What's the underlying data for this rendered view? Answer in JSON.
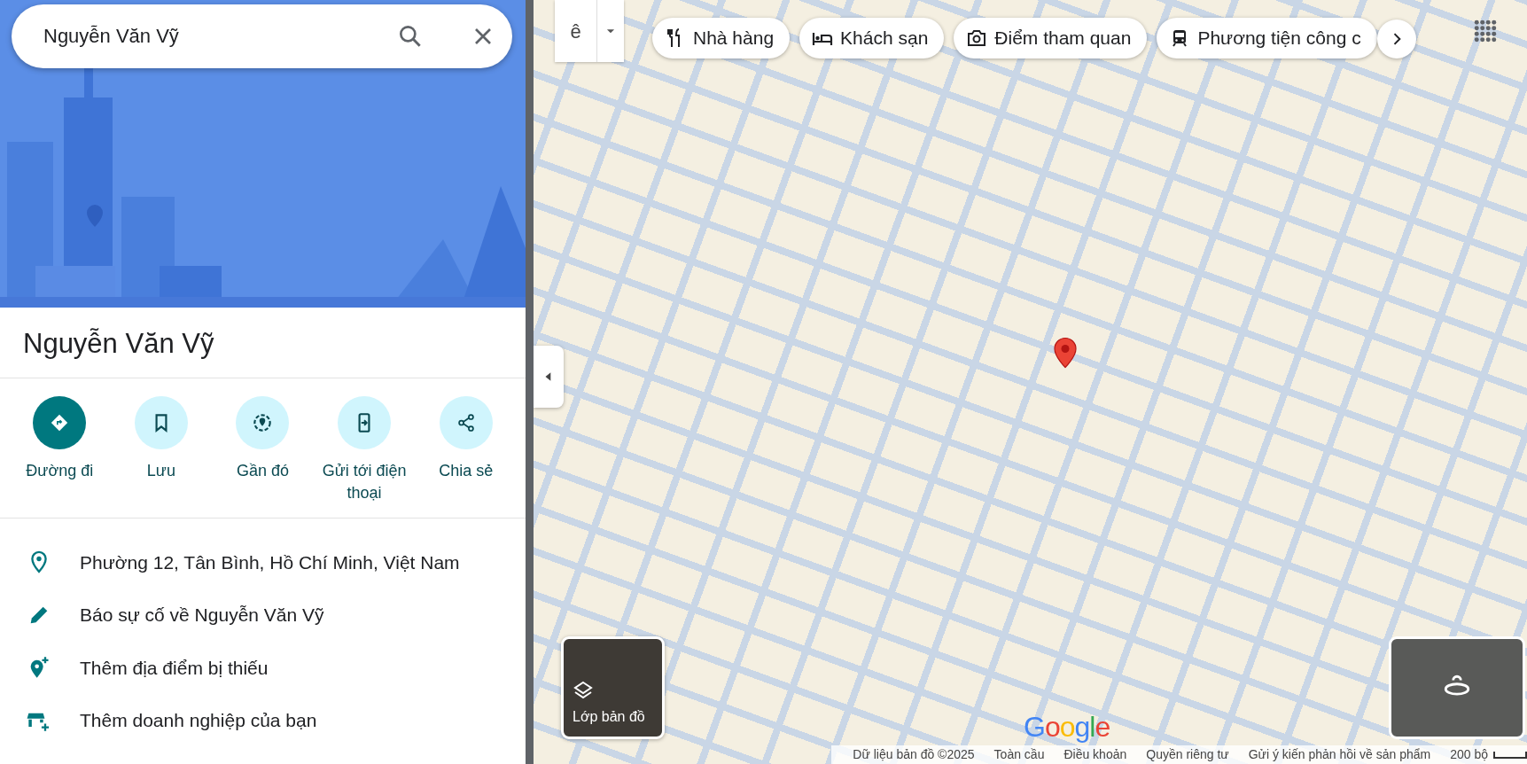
{
  "search": {
    "value": "Nguyễn Văn Vỹ"
  },
  "place": {
    "title": "Nguyễn Văn Vỹ"
  },
  "actions": [
    {
      "label": "Đường đi",
      "primary": true
    },
    {
      "label": "Lưu",
      "primary": false
    },
    {
      "label": "Gần đó",
      "primary": false
    },
    {
      "label": "Gửi tới điện thoại",
      "primary": false
    },
    {
      "label": "Chia sẻ",
      "primary": false
    }
  ],
  "details": [
    {
      "text": "Phường 12, Tân Bình, Hồ Chí Minh, Việt Nam"
    },
    {
      "text": "Báo sự cố về Nguyễn Văn Vỹ"
    },
    {
      "text": "Thêm địa điểm bị thiếu"
    },
    {
      "text": "Thêm doanh nghiệp của bạn"
    }
  ],
  "input_tool": {
    "label": "ê"
  },
  "chips": [
    {
      "label": "Nhà hàng"
    },
    {
      "label": "Khách sạn"
    },
    {
      "label": "Điểm tham quan"
    },
    {
      "label": "Phương tiện công c"
    }
  ],
  "layers_button": {
    "label": "Lớp bản đồ"
  },
  "logo": "Google",
  "footer": [
    "Dữ liệu bản đồ ©2025",
    "Toàn cầu",
    "Điều khoản",
    "Quyền riêng tư",
    "Gửi ý kiến phản hồi về sản phẩm"
  ],
  "scale": {
    "label": "200 bộ"
  }
}
